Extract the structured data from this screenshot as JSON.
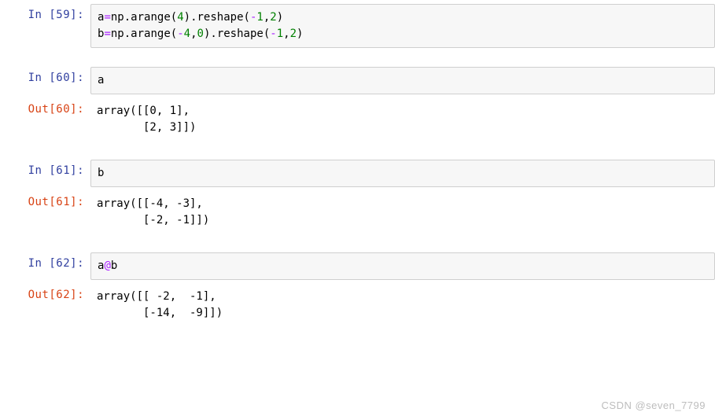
{
  "cells": [
    {
      "prompt_in": "In  [59]:",
      "code": {
        "line1": {
          "v1": "a",
          "op1": "=",
          "v2": "np",
          "p1": ".",
          "v3": "arange",
          "p2": "(",
          "n1": "4",
          "p3": ")",
          "p4": ".",
          "v4": "reshape",
          "p5": "(",
          "op2": "-",
          "n2": "1",
          "p6": ",",
          "n3": "2",
          "p7": ")"
        },
        "line2": {
          "v1": "b",
          "op1": "=",
          "v2": "np",
          "p1": ".",
          "v3": "arange",
          "p2": "(",
          "op2": "-",
          "n1": "4",
          "p3": ",",
          "n2": "0",
          "p4": ")",
          "p5": ".",
          "v4": "reshape",
          "p6": "(",
          "op3": "-",
          "n3": "1",
          "p7": ",",
          "n4": "2",
          "p8": ")"
        }
      }
    },
    {
      "prompt_in": "In  [60]:",
      "code_single": "a",
      "prompt_out": "Out[60]:",
      "output": "array([[0, 1],\n       [2, 3]])"
    },
    {
      "prompt_in": "In  [61]:",
      "code_single": "b",
      "prompt_out": "Out[61]:",
      "output": "array([[-4, -3],\n       [-2, -1]])"
    },
    {
      "prompt_in": "In  [62]:",
      "code62": {
        "v1": "a",
        "op": "@",
        "v2": "b"
      },
      "prompt_out": "Out[62]:",
      "output": "array([[ -2,  -1],\n       [-14,  -9]])"
    }
  ],
  "watermark": "CSDN @seven_7799"
}
